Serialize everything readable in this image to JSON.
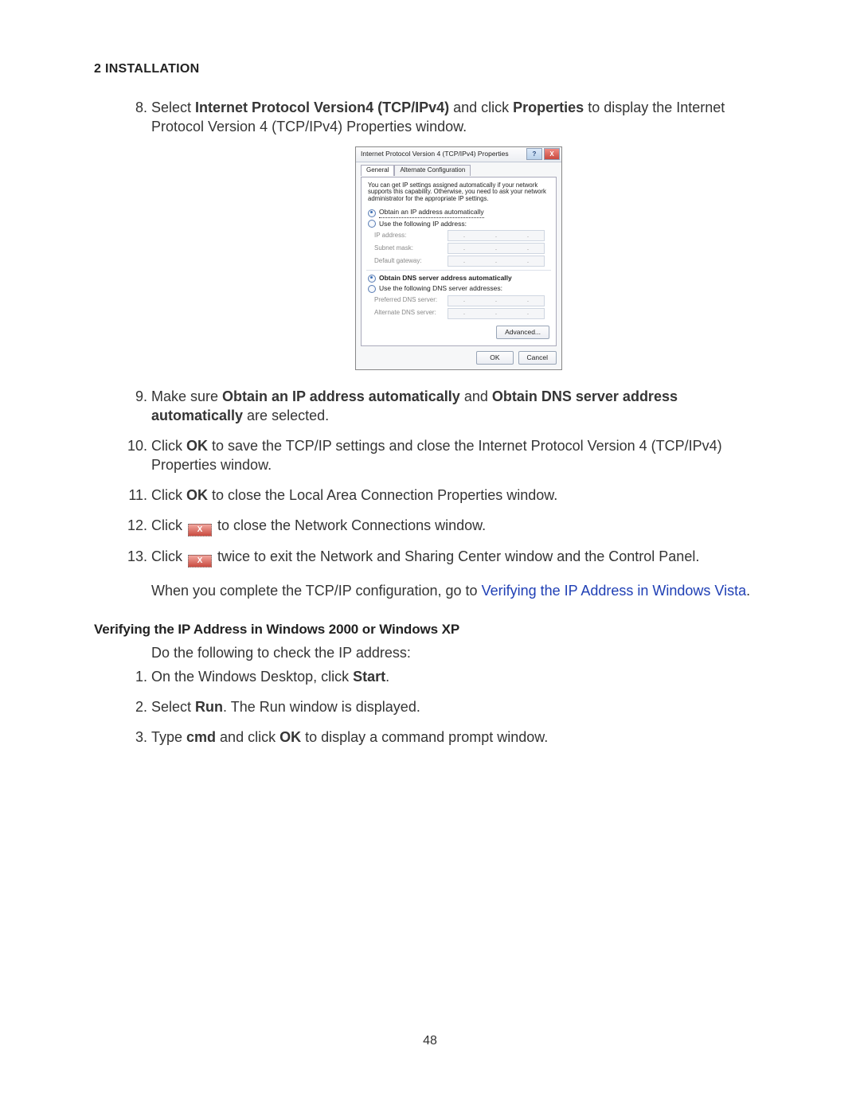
{
  "section_title": "2 INSTALLATION",
  "list8": {
    "num": "8.",
    "pre": "Select ",
    "b1": "Internet Protocol Version4 (TCP/IPv4)",
    "mid": " and click ",
    "b2": "Properties",
    "post": " to display the Internet Protocol Version 4 (TCP/IPv4) Properties window."
  },
  "dialog": {
    "title": "Internet Protocol Version 4 (TCP/IPv4) Properties",
    "help": "?",
    "close": "X",
    "tab1": "General",
    "tab2": "Alternate Configuration",
    "hint": "You can get IP settings assigned automatically if your network supports this capability. Otherwise, you need to ask your network administrator for the appropriate IP settings.",
    "r1": "Obtain an IP address automatically",
    "r2": "Use the following IP address:",
    "f_ip": "IP address:",
    "f_mask": "Subnet mask:",
    "f_gw": "Default gateway:",
    "r3": "Obtain DNS server address automatically",
    "r4": "Use the following DNS server addresses:",
    "f_pdns": "Preferred DNS server:",
    "f_adns": "Alternate DNS server:",
    "adv": "Advanced...",
    "ok": "OK",
    "cancel": "Cancel"
  },
  "list9": {
    "pre": "Make sure ",
    "b1": "Obtain an IP address automatically",
    "mid": " and ",
    "b2": "Obtain DNS server address automatically",
    "post": " are selected."
  },
  "list10": {
    "pre": "Click ",
    "b1": "OK",
    "post": " to save the TCP/IP settings and close the Internet Protocol Version 4 (TCP/IPv4) Properties window."
  },
  "list11": {
    "pre": "Click ",
    "b1": "OK",
    "post": " to close the Local Area Connection Properties window."
  },
  "list12": {
    "pre": "Click ",
    "chip": "X",
    "post": " to close the Network Connections window."
  },
  "list13": {
    "pre": "Click ",
    "chip": "X",
    "post": " twice to exit the Network and Sharing Center window and the Control Panel."
  },
  "closing": {
    "pre": "When you complete the TCP/IP configuration, go to ",
    "link": "Verifying the IP Address in Windows Vista",
    "post": "."
  },
  "subhead": "Verifying the IP Address in Windows 2000 or Windows XP",
  "intro2": "Do the following to check the IP address:",
  "s1": {
    "pre": "On the Windows Desktop, click ",
    "b": "Start",
    "post": "."
  },
  "s2": {
    "pre": "Select ",
    "b": "Run",
    "post": ". The Run window is displayed."
  },
  "s3": {
    "pre": "Type ",
    "b1": "cmd",
    "mid": " and click ",
    "b2": "OK",
    "post": " to display a command prompt window."
  },
  "page_number": "48"
}
